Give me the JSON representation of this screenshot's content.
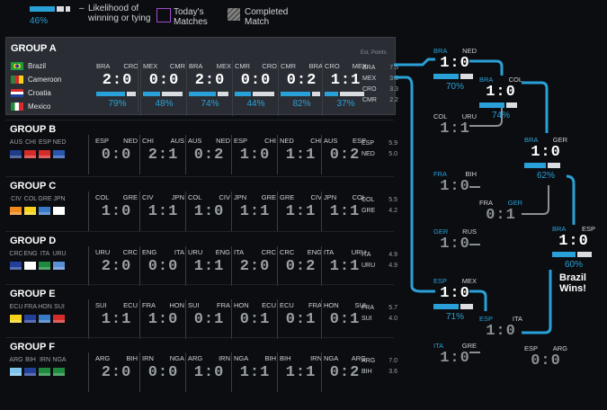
{
  "legend": {
    "percent": "46%",
    "dash": "–",
    "likelihood": "Likelihood of winning or tying",
    "today": "Today's Matches",
    "completed": "Completed Match"
  },
  "colors": {
    "accent": "#2aa0d8",
    "today": "#a24bd1"
  },
  "groups": [
    {
      "title": "GROUP A",
      "est": "Est. Points",
      "teams": [
        "Brazil",
        "Cameroon",
        "Croatia",
        "Mexico"
      ],
      "matches": [
        {
          "t1": "BRA",
          "t2": "CRO",
          "score": "2:0",
          "pct": "79%",
          "prob": 0.79
        },
        {
          "t1": "MEX",
          "t2": "CMR",
          "score": "0:0",
          "pct": "48%",
          "prob": 0.48
        },
        {
          "t1": "BRA",
          "t2": "MEX",
          "score": "2:0",
          "pct": "74%",
          "prob": 0.74
        },
        {
          "t1": "CMR",
          "t2": "CRO",
          "score": "0:0",
          "pct": "44%",
          "prob": 0.44
        },
        {
          "t1": "CMR",
          "t2": "BRA",
          "score": "0:2",
          "pct": "82%",
          "prob": 0.82
        },
        {
          "t1": "CRO",
          "t2": "MEX",
          "score": "1:1",
          "pct": "37%",
          "prob": 0.37
        }
      ],
      "standings": [
        [
          "BRA",
          "7.5"
        ],
        [
          "MEX",
          "3.6"
        ],
        [
          "CRO",
          "3.3"
        ],
        [
          "CMR",
          "2.2"
        ]
      ]
    },
    {
      "title": "GROUP B",
      "abbr": [
        "AUS",
        "CHI",
        "ESP",
        "NED"
      ],
      "matches": [
        {
          "t1": "ESP",
          "t2": "NED",
          "score": "0:0"
        },
        {
          "t1": "CHI",
          "t2": "AUS",
          "score": "2:1"
        },
        {
          "t1": "AUS",
          "t2": "NED",
          "score": "0:2"
        },
        {
          "t1": "ESP",
          "t2": "CHI",
          "score": "1:0"
        },
        {
          "t1": "NED",
          "t2": "CHI",
          "score": "1:1"
        },
        {
          "t1": "AUS",
          "t2": "ESP",
          "score": "0:2"
        }
      ],
      "standings": [
        [
          "ESP",
          "5.9"
        ],
        [
          "NED",
          "5.0"
        ]
      ]
    },
    {
      "title": "GROUP C",
      "abbr": [
        "CIV",
        "COL",
        "GRE",
        "JPN"
      ],
      "matches": [
        {
          "t1": "COL",
          "t2": "GRE",
          "score": "1:0"
        },
        {
          "t1": "CIV",
          "t2": "JPN",
          "score": "1:1"
        },
        {
          "t1": "COL",
          "t2": "CIV",
          "score": "1:0"
        },
        {
          "t1": "JPN",
          "t2": "GRE",
          "score": "1:1"
        },
        {
          "t1": "GRE",
          "t2": "CIV",
          "score": "1:1"
        },
        {
          "t1": "JPN",
          "t2": "COL",
          "score": "1:1"
        }
      ],
      "standings": [
        [
          "COL",
          "5.5"
        ],
        [
          "GRE",
          "4.2"
        ]
      ]
    },
    {
      "title": "GROUP D",
      "abbr": [
        "CRC",
        "ENG",
        "ITA",
        "URU"
      ],
      "matches": [
        {
          "t1": "URU",
          "t2": "CRC",
          "score": "2:0"
        },
        {
          "t1": "ENG",
          "t2": "ITA",
          "score": "0:0"
        },
        {
          "t1": "URU",
          "t2": "ENG",
          "score": "1:1"
        },
        {
          "t1": "ITA",
          "t2": "CRC",
          "score": "2:0"
        },
        {
          "t1": "CRC",
          "t2": "ENG",
          "score": "0:2"
        },
        {
          "t1": "ITA",
          "t2": "URU",
          "score": "1:1"
        }
      ],
      "standings": [
        [
          "ITA",
          "4.9"
        ],
        [
          "URU",
          "4.9"
        ]
      ]
    },
    {
      "title": "GROUP E",
      "abbr": [
        "ECU",
        "FRA",
        "HON",
        "SUI"
      ],
      "matches": [
        {
          "t1": "SUI",
          "t2": "ECU",
          "score": "1:1"
        },
        {
          "t1": "FRA",
          "t2": "HON",
          "score": "1:0"
        },
        {
          "t1": "SUI",
          "t2": "FRA",
          "score": "0:1"
        },
        {
          "t1": "HON",
          "t2": "ECU",
          "score": "0:1"
        },
        {
          "t1": "ECU",
          "t2": "FRA",
          "score": "0:1"
        },
        {
          "t1": "HON",
          "t2": "SUI",
          "score": "0:1"
        }
      ],
      "standings": [
        [
          "FRA",
          "5.7"
        ],
        [
          "SUI",
          "4.0"
        ]
      ]
    },
    {
      "title": "GROUP F",
      "abbr": [
        "ARG",
        "BIH",
        "IRN",
        "NGA"
      ],
      "matches": [
        {
          "t1": "ARG",
          "t2": "BIH",
          "score": "2:0"
        },
        {
          "t1": "IRN",
          "t2": "NGA",
          "score": "0:0"
        },
        {
          "t1": "ARG",
          "t2": "IRN",
          "score": "1:0"
        },
        {
          "t1": "NGA",
          "t2": "BIH",
          "score": "1:1"
        },
        {
          "t1": "BIH",
          "t2": "IRN",
          "score": "1:1"
        },
        {
          "t1": "NGA",
          "t2": "ARG",
          "score": "0:2"
        }
      ],
      "standings": [
        [
          "ARG",
          "7.0"
        ],
        [
          "BIH",
          "3.6"
        ]
      ]
    }
  ],
  "bracket": {
    "r16a": {
      "t1": "BRA",
      "t2": "NED",
      "score": "1:0",
      "pct": "70%",
      "prob": 0.7
    },
    "r16b": {
      "t1": "COL",
      "t2": "URU",
      "score": "1:1"
    },
    "r16c": {
      "t1": "FRA",
      "t2": "BIH",
      "score": "1:0"
    },
    "r16d": {
      "t1": "GER",
      "t2": "RUS",
      "score": "1:0"
    },
    "r16e": {
      "t1": "ESP",
      "t2": "MEX",
      "score": "1:0",
      "pct": "71%",
      "prob": 0.71
    },
    "r16f": {
      "t1": "ITA",
      "t2": "GRE",
      "score": "1:0"
    },
    "qfa": {
      "t1": "BRA",
      "t2": "COL",
      "score": "1:0",
      "pct": "74%",
      "prob": 0.74
    },
    "qfb": {
      "t1": "FRA",
      "t2": "GER",
      "score": "0:1"
    },
    "qfc": {
      "t1": "ESP",
      "t2": "ITA",
      "score": "1:0"
    },
    "sfa": {
      "t1": "BRA",
      "t2": "GER",
      "score": "1:0",
      "pct": "62%",
      "prob": 0.62
    },
    "sfb": {
      "t1": "ESP",
      "t2": "ARG",
      "score": "0:0"
    },
    "final": {
      "t1": "BRA",
      "t2": "ESP",
      "score": "1:0",
      "pct": "60%",
      "prob": 0.6
    },
    "wins": "Brazil Wins!"
  }
}
